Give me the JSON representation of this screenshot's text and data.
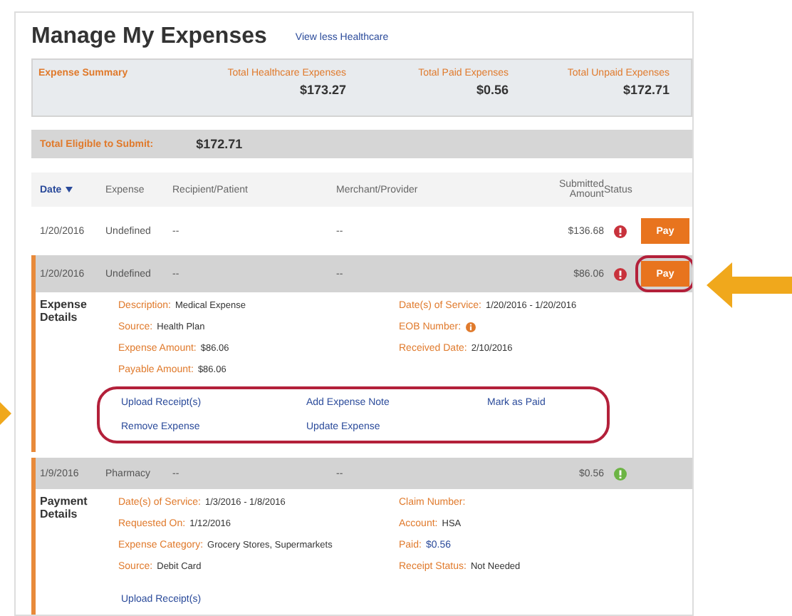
{
  "page": {
    "title": "Manage My Expenses",
    "link": "View less Healthcare"
  },
  "summary": {
    "label": "Expense Summary",
    "totals": [
      {
        "label": "Total Healthcare Expenses",
        "value": "$173.27"
      },
      {
        "label": "Total Paid Expenses",
        "value": "$0.56"
      },
      {
        "label": "Total Unpaid Expenses",
        "value": "$172.71"
      }
    ]
  },
  "eligible": {
    "label": "Total Eligible to Submit:",
    "value": "$172.71"
  },
  "table": {
    "columns": [
      {
        "label": "Date",
        "sorted": true
      },
      {
        "label": "Expense",
        "sorted": false
      },
      {
        "label": "Recipient/Patient",
        "sorted": false
      },
      {
        "label": "Merchant/Provider",
        "sorted": false
      },
      {
        "label": "Submitted Amount",
        "sorted": false
      },
      {
        "label": "Status",
        "sorted": false
      }
    ],
    "rows": [
      {
        "date": "1/20/2016",
        "expense": "Undefined",
        "recipient": "--",
        "merchant": "--",
        "amount": "$136.68",
        "paid": false,
        "pay": "Pay",
        "expanded": false
      },
      {
        "date": "1/20/2016",
        "expense": "Undefined",
        "recipient": "--",
        "merchant": "--",
        "amount": "$86.06",
        "paid": false,
        "pay": "Pay",
        "circled": true,
        "expanded": true,
        "details": {
          "title": "Expense Details",
          "fields": [
            {
              "label": "Description:",
              "value": "Medical Expense"
            },
            {
              "label": "Date(s) of Service:",
              "value": "1/20/2016 - 1/20/2016"
            },
            {
              "label": "Source:",
              "value": "Health Plan"
            },
            {
              "label": "EOB Number:",
              "kind": "info"
            },
            {
              "label": "Expense Amount:",
              "value": "$86.06"
            },
            {
              "label": "Received Date:",
              "value": "2/10/2016"
            },
            {
              "label": "Payable Amount:",
              "value": "$86.06"
            }
          ],
          "links": [
            "Upload Receipt(s)",
            "Add Expense Note",
            "Mark as Paid",
            "Remove Expense",
            "Update Expense"
          ],
          "highlighted": true
        }
      },
      {
        "date": "1/9/2016",
        "expense": "Pharmacy",
        "recipient": "--",
        "merchant": "--",
        "amount": "$0.56",
        "paid": true,
        "expanded": true,
        "details": {
          "title": "Payment Details",
          "fields": [
            {
              "label": "Date(s) of Service:",
              "value": "1/3/2016 - 1/8/2016"
            },
            {
              "label": "Claim Number:"
            },
            {
              "label": "Requested On:",
              "value": "1/12/2016"
            },
            {
              "label": "Account:",
              "value": "HSA"
            },
            {
              "label": "Expense Category:",
              "value": "Grocery Stores, Supermarkets"
            },
            {
              "label": "Paid:",
              "value": "$0.56",
              "kind": "link"
            },
            {
              "label": "Source:",
              "value": "Debit Card"
            },
            {
              "label": "Receipt Status:",
              "value": "Not Needed"
            }
          ],
          "links": [
            "Upload Receipt(s)"
          ],
          "highlighted": false
        }
      }
    ]
  }
}
